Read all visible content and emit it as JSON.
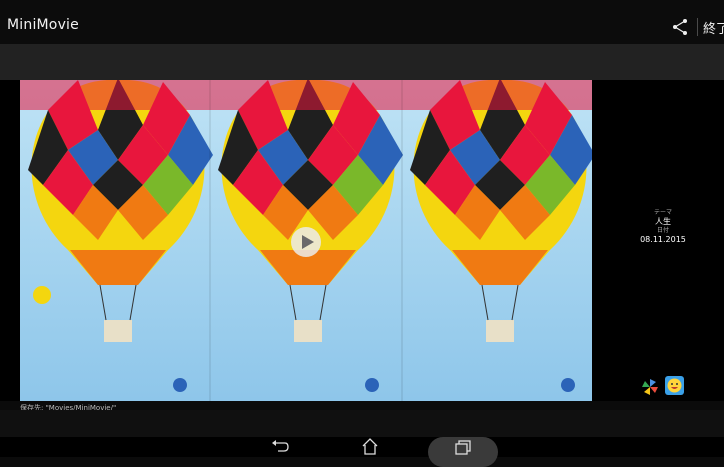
{
  "app": {
    "title": "MiniMovie"
  },
  "header": {
    "share_icon": "share-icon",
    "finish_label": "終了"
  },
  "info": {
    "theme_label": "テーマ",
    "theme_value": "人生",
    "date_label": "日付",
    "date_value": "08.11.2015"
  },
  "footer": {
    "save_path": "保存先: \"Movies/MiniMovie/\""
  },
  "nav": {
    "back": "back-icon",
    "home": "home-icon",
    "recent": "recent-apps-icon"
  },
  "colors": {
    "sky": "#9dd0ef",
    "balloon_yellow": "#f4d60f",
    "balloon_red": "#e8163d",
    "accent_blue": "#2b63b8"
  }
}
